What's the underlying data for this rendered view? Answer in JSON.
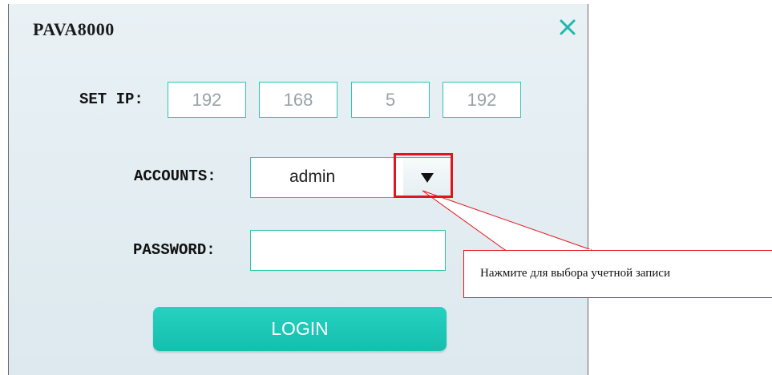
{
  "dialog": {
    "title": "PAVA8000",
    "close_icon": "close-icon"
  },
  "ip": {
    "label": "SET IP:",
    "octets": [
      "192",
      "168",
      "5",
      "192"
    ]
  },
  "accounts": {
    "label": "ACCOUNTS:",
    "selected": "admin",
    "dropdown_icon": "dropdown-triangle-icon"
  },
  "password": {
    "label": "PASSWORD:",
    "value": ""
  },
  "login": {
    "label": "LOGIN"
  },
  "annotation": {
    "text": "Нажмите для выбора учетной записи",
    "color": "#e3141b"
  },
  "colors": {
    "accent": "#1ccab7",
    "field_border": "#2ec4b0",
    "close": "#1fb8aa"
  }
}
